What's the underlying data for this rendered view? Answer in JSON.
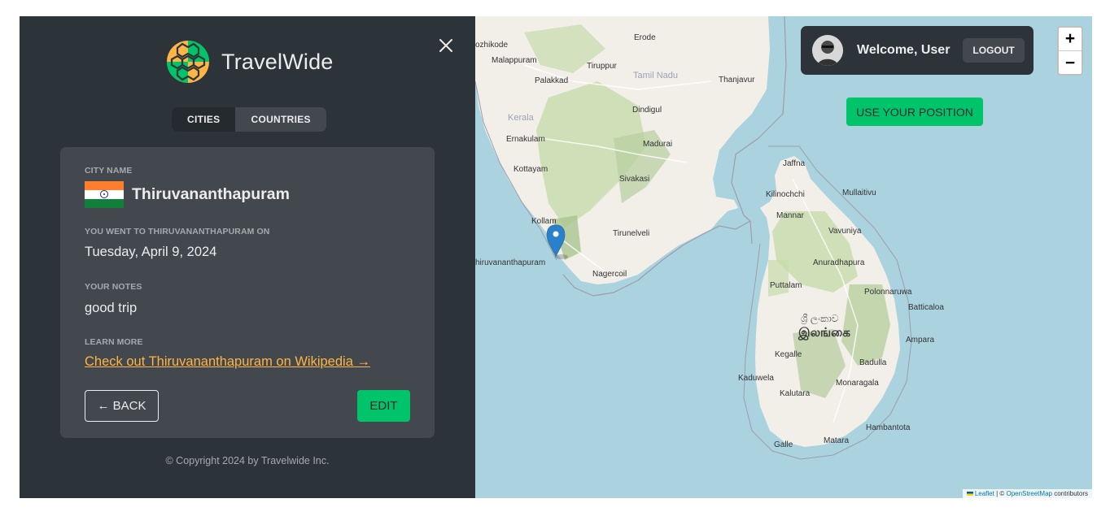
{
  "app": {
    "name": "TravelWide"
  },
  "tabs": [
    {
      "label": "CITIES",
      "active": true
    },
    {
      "label": "COUNTRIES",
      "active": false
    }
  ],
  "city": {
    "name_label": "CITY NAME",
    "name": "Thiruvananthapuram",
    "flag_icon": "india-flag-icon",
    "visit_label": "YOU WENT TO THIRUVANANTHAPURAM ON",
    "visit_date": "Tuesday, April 9, 2024",
    "notes_label": "YOUR NOTES",
    "notes": "good trip",
    "learn_label": "LEARN MORE",
    "wiki_link": "Check out Thiruvananthapuram on Wikipedia →",
    "back_label": "← BACK",
    "edit_label": "EDIT"
  },
  "footer": {
    "copyright": "© Copyright 2024 by Travelwide Inc."
  },
  "user": {
    "welcome": "Welcome, User",
    "logout_label": "LOGOUT"
  },
  "map": {
    "zoom_in": "+",
    "zoom_out": "−",
    "use_position_label": "USE YOUR POSITION",
    "attribution": {
      "leaflet": "Leaflet",
      "sep": " | © ",
      "osm": "OpenStreetMap",
      "suffix": " contributors"
    },
    "places": [
      "ozhikode",
      "Erode",
      "Malappuram",
      "Tiruppur",
      "Palakkad",
      "Tamil Nadu",
      "Thanjavur",
      "Kerala",
      "Dindigul",
      "Ernakulam",
      "Madurai",
      "Jaffna",
      "Kottayam",
      "Sivakasi",
      "Kilinochchi",
      "Mullaitivu",
      "Mannar",
      "Kollam",
      "Vavuniya",
      "Tirunelveli",
      "Anuradhapura",
      "hiruvananthapuram",
      "Nagercoil",
      "Puttalam",
      "Polonnaruwa",
      "Batticaloa",
      "ශ්‍රී ලංකාව",
      "இலங்கை",
      "Ampara",
      "Kegalle",
      "Badulla",
      "Kaduwela",
      "Monaragala",
      "Kalutara",
      "Hambantota",
      "Galle",
      "Matara"
    ],
    "colors": {
      "sea": "#aad3df",
      "land": "#f2efe9",
      "forest": "#b7cf9e",
      "marker": "#2a81cb"
    }
  },
  "colors": {
    "accent": "#00c46a",
    "link": "#ffb545",
    "panel": "#2d3439",
    "card": "#42484e"
  }
}
